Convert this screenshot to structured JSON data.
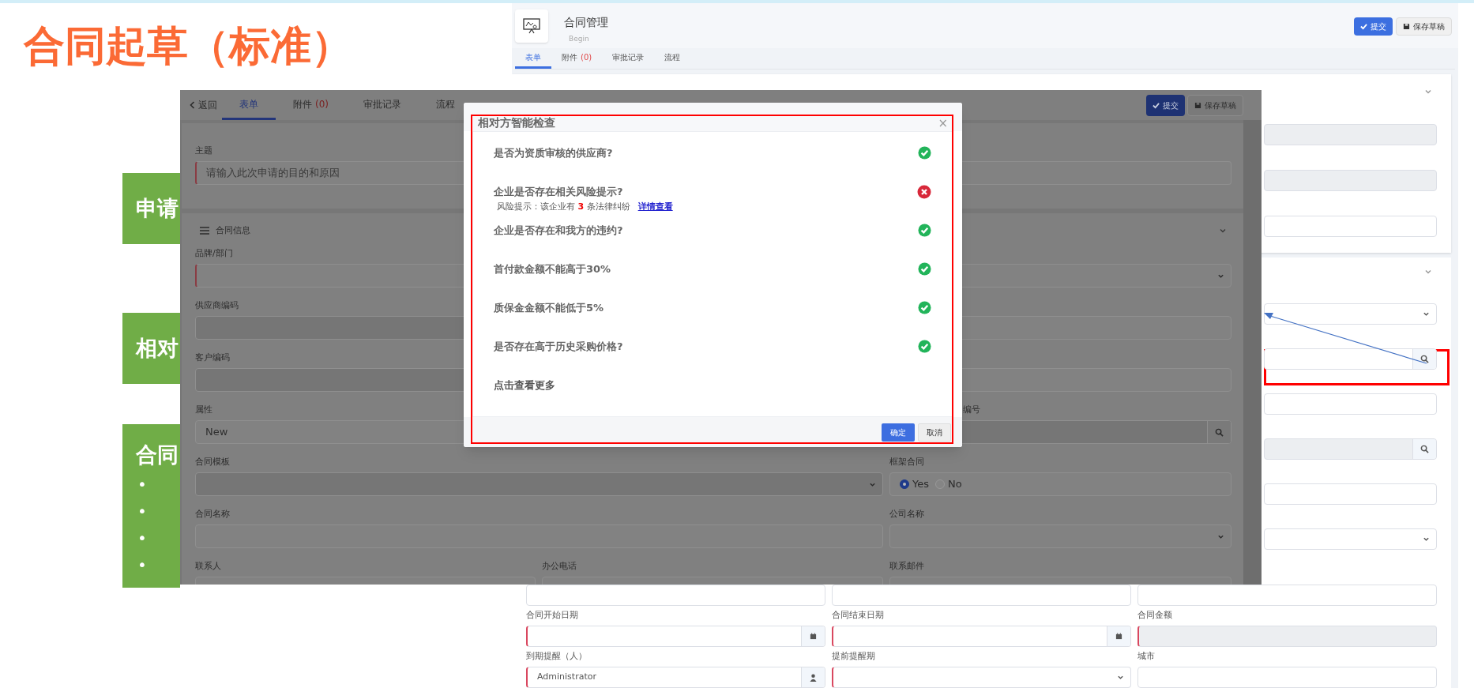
{
  "slide": {
    "title": "合同起草（标准）"
  },
  "callouts": [
    {
      "text": "申请"
    },
    {
      "text": "相对"
    },
    {
      "text": "合同",
      "bullets": [
        "•",
        "•",
        "•",
        "•"
      ]
    }
  ],
  "back_window": {
    "title": "合同管理",
    "subtitle": "Begin",
    "buttons": [
      {
        "label": "提交",
        "kind": "primary"
      },
      {
        "label": "保存草稿",
        "kind": "default"
      }
    ],
    "tabs": [
      {
        "label": "表单",
        "selected": true
      },
      {
        "label": "附件",
        "count": "(0)",
        "selected": false
      },
      {
        "label": "审批记录",
        "selected": false
      },
      {
        "label": "流程",
        "selected": false
      }
    ],
    "card1_fields": [
      {
        "kind": "readonly"
      },
      {
        "kind": "readonly"
      },
      {
        "kind": "text"
      }
    ],
    "card2_fields": [
      {
        "kind": "select"
      },
      {
        "kind": "search"
      },
      {
        "kind": "text"
      },
      {
        "kind": "readonly-search"
      },
      {
        "kind": "text"
      },
      {
        "kind": "select"
      }
    ],
    "grid_rows": [
      [
        {
          "kind": "text"
        },
        {
          "kind": "text"
        },
        {
          "kind": "text"
        }
      ],
      [
        {
          "label": "合同开始日期",
          "kind": "date",
          "required": true
        },
        {
          "label": "合同结束日期",
          "kind": "date",
          "required": true
        },
        {
          "label": "合同金额",
          "kind": "readonly",
          "required": true
        }
      ],
      [
        {
          "label": "到期提醒（人）",
          "kind": "person",
          "required": true,
          "value": "Administrator"
        },
        {
          "label": "提前提醒期",
          "kind": "select",
          "required": true
        },
        {
          "label": "城市",
          "kind": "text"
        }
      ]
    ]
  },
  "front_window": {
    "back": "返回",
    "tabs": [
      {
        "label": "表单",
        "selected": true
      },
      {
        "label": "附件",
        "count": "(0)",
        "selected": false
      },
      {
        "label": "审批记录",
        "selected": false
      },
      {
        "label": "流程",
        "selected": false
      }
    ],
    "buttons": [
      {
        "label": "提交",
        "kind": "primary"
      },
      {
        "label": "保存草稿",
        "kind": "default"
      }
    ],
    "subject": {
      "label": "主题",
      "required": true,
      "placeholder": "请输入此次申请的目的和原因"
    },
    "section": {
      "title": "合同信息"
    },
    "rows": [
      {
        "left": {
          "label": "品牌/部门",
          "kind": "text",
          "required": true
        },
        "right": {
          "kind": "select"
        }
      },
      {
        "left": {
          "label": "供应商编码",
          "kind": "readonly"
        },
        "right": {
          "kind": "text"
        }
      },
      {
        "left": {
          "label": "客户编码",
          "kind": "readonly"
        },
        "right": {
          "kind": "text"
        }
      },
      {
        "left": {
          "label": "属性",
          "kind": "text",
          "value": "New"
        },
        "right": {
          "label_cut": "编号",
          "kind": "readonly-search"
        }
      },
      {
        "left": {
          "label": "合同模板",
          "kind": "readonly-select"
        },
        "right": {
          "label": "框架合同",
          "kind": "radio",
          "options": [
            {
              "label": "Yes",
              "selected": true
            },
            {
              "label": "No",
              "selected": false
            }
          ]
        }
      },
      {
        "left": {
          "label": "合同名称",
          "kind": "text"
        },
        "right": {
          "label": "公司名称",
          "kind": "select"
        }
      }
    ],
    "contacts": [
      {
        "label": "联系人"
      },
      {
        "label": "办公电话"
      },
      {
        "label": "联系邮件"
      }
    ]
  },
  "dialog": {
    "title": "相对方智能检查",
    "close": "×",
    "items": [
      {
        "text": "是否为资质审核的供应商?",
        "passed": true
      },
      {
        "text": "企业是否存在相关风险提示?",
        "passed": false,
        "note": "风险提示：该企业有 **3** 条法律纠纷",
        "link": "详情查看"
      },
      {
        "text": "企业是否存在和我方的违约?",
        "passed": true
      },
      {
        "text": "首付款金额不能高于30%",
        "passed": true
      },
      {
        "text": "质保金金额不能低于5%",
        "passed": true
      },
      {
        "text": "是否存在高于历史采购价格?",
        "passed": true
      },
      {
        "text": "点击查看更多",
        "kind": "more"
      }
    ],
    "buttons": [
      {
        "label": "确定",
        "kind": "primary"
      },
      {
        "label": "取消",
        "kind": "default"
      }
    ]
  }
}
